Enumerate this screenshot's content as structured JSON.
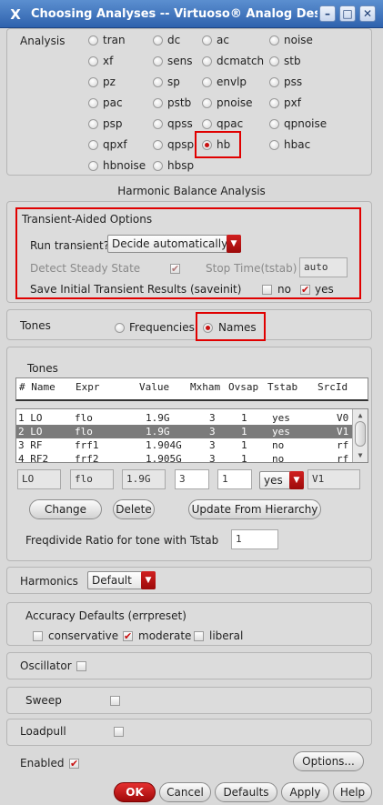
{
  "window": {
    "title": "Choosing Analyses -- Virtuoso® Analog Des",
    "app_icon": "X",
    "min": "–",
    "max": "□",
    "close": "✕"
  },
  "analysis": {
    "label": "Analysis",
    "options": [
      "tran",
      "dc",
      "ac",
      "noise",
      "xf",
      "sens",
      "dcmatch",
      "stb",
      "pz",
      "sp",
      "envlp",
      "pss",
      "pac",
      "pstb",
      "pnoise",
      "pxf",
      "psp",
      "qpss",
      "qpac",
      "qpnoise",
      "qpxf",
      "qpsp",
      "hb",
      "hbac",
      "hbnoise",
      "hbsp"
    ],
    "selected": "hb"
  },
  "section_title": "Harmonic Balance Analysis",
  "transient": {
    "title": "Transient-Aided Options",
    "run_label": "Run transient?",
    "run_value": "Decide automatically",
    "detect_label": "Detect Steady State",
    "stop_label": "Stop Time(tstab)",
    "stop_value": "auto",
    "save_label": "Save Initial Transient Results (saveinit)",
    "no_label": "no",
    "yes_label": "yes"
  },
  "tones_select": {
    "label": "Tones",
    "freq_label": "Frequencies",
    "names_label": "Names"
  },
  "tones": {
    "title": "Tones",
    "headers": [
      "# Name",
      "Expr",
      "Value",
      "Mxham",
      "Ovsap",
      "Tstab",
      "SrcId"
    ],
    "rows": [
      [
        "1 LO",
        "flo",
        "1.9G",
        "3",
        "1",
        "yes",
        "V0"
      ],
      [
        "2 LO",
        "flo",
        "1.9G",
        "3",
        "1",
        "yes",
        "V1"
      ],
      [
        "3 RF",
        "frf1",
        "1.904G",
        "3",
        "1",
        "no",
        "rf"
      ],
      [
        "4 RF2",
        "frf2",
        "1.905G",
        "3",
        "1",
        "no",
        "rf"
      ]
    ],
    "edit": {
      "name": "LO",
      "expr": "flo",
      "value": "1.9G",
      "mxham": "3",
      "ovsap": "1",
      "tstab": "yes",
      "srcid": "V1"
    },
    "change": "Change",
    "delete": "Delete",
    "update": "Update From Hierarchy",
    "freqdiv_label": "Freqdivide Ratio for tone with Tstab",
    "freqdiv_value": "1"
  },
  "harmonics": {
    "label": "Harmonics",
    "value": "Default"
  },
  "accuracy": {
    "title": "Accuracy Defaults (errpreset)",
    "conservative": "conservative",
    "moderate": "moderate",
    "liberal": "liberal"
  },
  "oscillator": "Oscillator",
  "sweep": "Sweep",
  "loadpull": "Loadpull",
  "enabled": "Enabled",
  "options_btn": "Options...",
  "buttons": {
    "ok": "OK",
    "cancel": "Cancel",
    "defaults": "Defaults",
    "apply": "Apply",
    "help": "Help"
  },
  "icons": {
    "check": "✔",
    "dropdown": "▼",
    "scroll_up": "▲",
    "scroll_down": "▼"
  }
}
